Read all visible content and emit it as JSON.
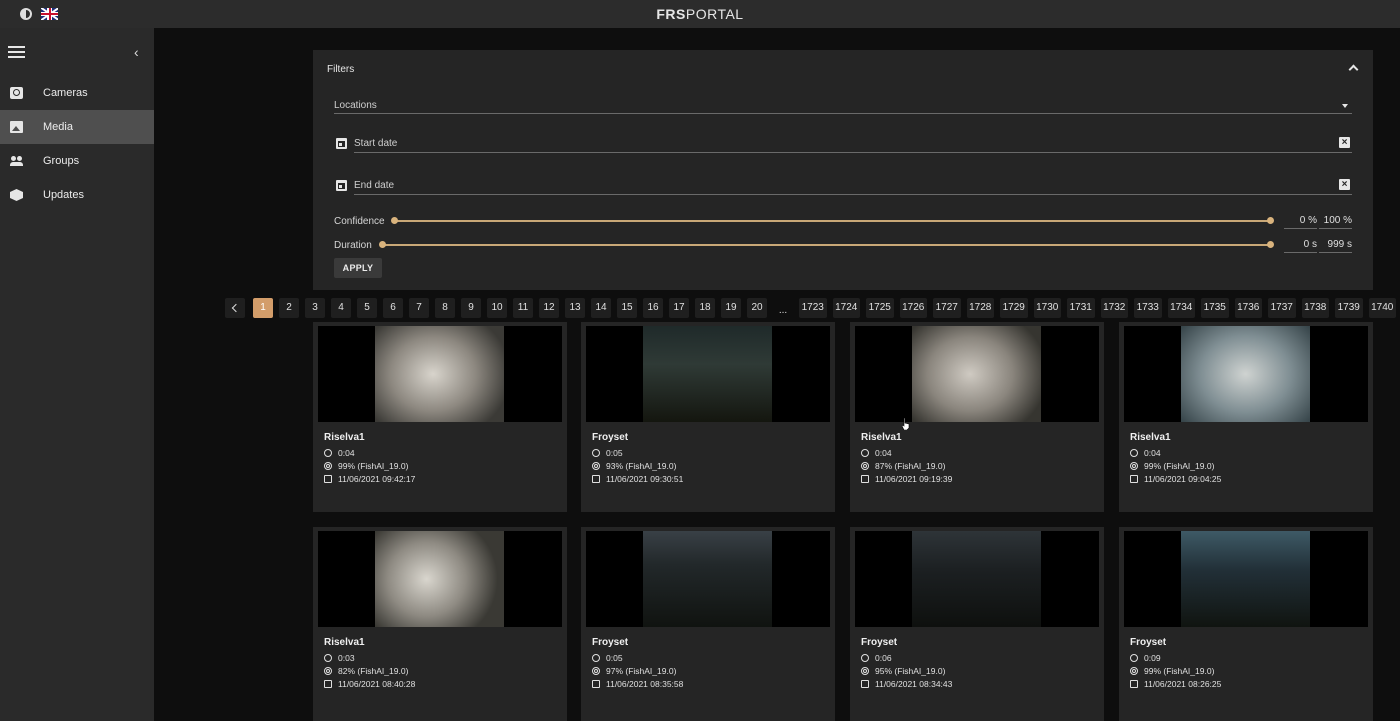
{
  "app": {
    "brand_bold": "FRS",
    "brand_rest": "PORTAL"
  },
  "sidebar": {
    "items": [
      {
        "label": "Cameras",
        "icon": "camera-icon"
      },
      {
        "label": "Media",
        "icon": "media-icon",
        "active": true
      },
      {
        "label": "Groups",
        "icon": "groups-icon"
      },
      {
        "label": "Updates",
        "icon": "updates-icon"
      }
    ]
  },
  "filters": {
    "title": "Filters",
    "locations_label": "Locations",
    "start_date_label": "Start date",
    "end_date_label": "End date",
    "confidence": {
      "label": "Confidence",
      "min": "0 %",
      "max": "100 %"
    },
    "duration": {
      "label": "Duration",
      "min": "0 s",
      "max": "999 s"
    },
    "apply_label": "APPLY"
  },
  "pagination": {
    "pages_start": [
      "1",
      "2",
      "3",
      "4",
      "5",
      "6",
      "7",
      "8",
      "9",
      "10",
      "11",
      "12",
      "13",
      "14",
      "15",
      "16",
      "17",
      "18",
      "19",
      "20"
    ],
    "ellipsis": "...",
    "pages_end": [
      "1723",
      "1724",
      "1725",
      "1726",
      "1727",
      "1728",
      "1729",
      "1730",
      "1731",
      "1732",
      "1733",
      "1734",
      "1735",
      "1736",
      "1737",
      "1738",
      "1739",
      "1740"
    ],
    "current": "1"
  },
  "media": [
    {
      "name": "Riselva1",
      "duration": "0:04",
      "confidence": "99% (FishAI_19.0)",
      "date": "11/06/2021 09:42:17"
    },
    {
      "name": "Froyset",
      "duration": "0:05",
      "confidence": "93% (FishAI_19.0)",
      "date": "11/06/2021 09:30:51"
    },
    {
      "name": "Riselva1",
      "duration": "0:04",
      "confidence": "87% (FishAI_19.0)",
      "date": "11/06/2021 09:19:39"
    },
    {
      "name": "Riselva1",
      "duration": "0:04",
      "confidence": "99% (FishAI_19.0)",
      "date": "11/06/2021 09:04:25"
    },
    {
      "name": "Riselva1",
      "duration": "0:03",
      "confidence": "82% (FishAI_19.0)",
      "date": "11/06/2021 08:40:28"
    },
    {
      "name": "Froyset",
      "duration": "0:05",
      "confidence": "97% (FishAI_19.0)",
      "date": "11/06/2021 08:35:58"
    },
    {
      "name": "Froyset",
      "duration": "0:06",
      "confidence": "95% (FishAI_19.0)",
      "date": "11/06/2021 08:34:43"
    },
    {
      "name": "Froyset",
      "duration": "0:09",
      "confidence": "99% (FishAI_19.0)",
      "date": "11/06/2021 08:26:25"
    }
  ],
  "colors": {
    "accent": "#d39d6a",
    "slider": "#c9a877",
    "sidebar_bg": "#2a2a2a",
    "active_item": "#4f4f4f"
  }
}
